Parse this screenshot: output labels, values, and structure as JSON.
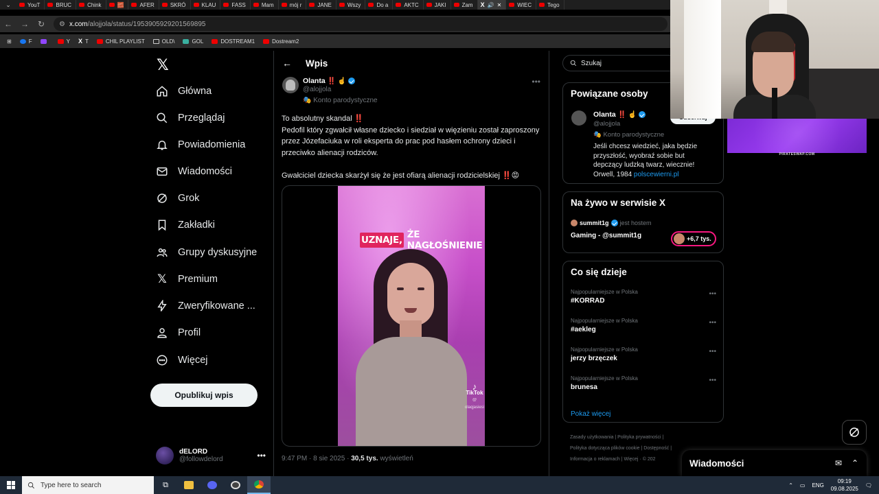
{
  "browser": {
    "tabs": [
      {
        "label": "YouT"
      },
      {
        "label": "BRUC"
      },
      {
        "label": "Chink"
      },
      {
        "label": "🧱"
      },
      {
        "label": "AFER"
      },
      {
        "label": "SKRÓ"
      },
      {
        "label": "KLAU"
      },
      {
        "label": "FASS"
      },
      {
        "label": "Mam"
      },
      {
        "label": "mój r"
      },
      {
        "label": "JANE"
      },
      {
        "label": "Wszy"
      },
      {
        "label": "Do a"
      },
      {
        "label": "AKTC"
      },
      {
        "label": "JAKI"
      },
      {
        "label": "Zam"
      },
      {
        "label": "X"
      },
      {
        "label": "WIEC"
      },
      {
        "label": "Tego"
      }
    ],
    "url_domain": "x.com",
    "url_path": "/alojjola/status/1953905929201569895",
    "bookmarks": [
      {
        "label": "F"
      },
      {
        "label": ""
      },
      {
        "label": "Y"
      },
      {
        "label": "T"
      },
      {
        "label": "CHIL PLAYLIST"
      },
      {
        "label": "OLD\\"
      },
      {
        "label": "GOL"
      },
      {
        "label": "DOSTREAM1"
      },
      {
        "label": "Dostream2"
      }
    ]
  },
  "sidebar": {
    "nav": [
      {
        "label": "Główna"
      },
      {
        "label": "Przeglądaj"
      },
      {
        "label": "Powiadomienia"
      },
      {
        "label": "Wiadomości"
      },
      {
        "label": "Grok"
      },
      {
        "label": "Zakładki"
      },
      {
        "label": "Grupy dyskusyjne"
      },
      {
        "label": "Premium"
      },
      {
        "label": "Zweryfikowane ..."
      },
      {
        "label": "Profil"
      },
      {
        "label": "Więcej"
      }
    ],
    "post_button": "Opublikuj wpis",
    "account": {
      "name": "dELORD",
      "handle": "@followdelord"
    }
  },
  "main": {
    "title": "Wpis",
    "author": {
      "name": "Olanta",
      "emojis": "‼️ ☝️",
      "handle": "@alojjola",
      "parody_label": "Konto parodystyczne"
    },
    "text": "To absolutny skandal ‼️\nPedofil który zgwałcił własne dziecko i siedział w więzieniu został zaproszony przez Józefaciuka w roli eksperta do prac pod hasłem ochrony dzieci i przeciwko alienacji rodziców.\n\nGwałciciel dziecka skarżył się że jest ofiarą alienacji rodzicielskiej ‼️😡",
    "video_caption_highlight": "UZNAJE,",
    "video_caption_rest": "ŻE NAGŁOŚNIENIE",
    "tiktok_label": "TikTok",
    "tiktok_handle": "@ olaqjasiesi",
    "time": "9:47 PM",
    "date": "8 sie 2025",
    "views": "30,5 tys.",
    "views_label": "wyświetleń"
  },
  "right": {
    "search_placeholder": "Szukaj",
    "related": {
      "title": "Powiązane osoby",
      "name": "Olanta",
      "emojis": "‼️ ☝️",
      "handle": "@alojjola",
      "parody_label": "Konto parodystyczne",
      "follow_label": "Obserwuj",
      "bio": "Jeśli chcesz wiedzieć, jaka będzie przyszłość, wyobraź sobie but depczący ludzką twarz, wiecznie! Orwell, 1984",
      "bio_link": "polscewierni.pl"
    },
    "live": {
      "title": "Na żywo w serwisie X",
      "host": "summit1g",
      "host_suffix": "jest hostem",
      "stream_title": "Gaming - @summit1g",
      "listeners": "+6,7 tys."
    },
    "trends": {
      "title": "Co się dzieje",
      "items": [
        {
          "context": "Najpopularniejsze w Polska",
          "name": "#KORRAD"
        },
        {
          "context": "Najpopularniejsze w Polska",
          "name": "#aekleg"
        },
        {
          "context": "Najpopularniejsze w Polska",
          "name": "jerzy brzęczek"
        },
        {
          "context": "Najpopularniejsze w Polska",
          "name": "brunesa"
        }
      ],
      "show_more": "Pokaż więcej"
    },
    "footer": {
      "links": [
        "Zasady użytkowania",
        "Polityka prywatności",
        "Polityka dotycząca plików cookie",
        "Dostępność",
        "Informacja o reklamach",
        "Więcej",
        "© 202"
      ]
    }
  },
  "overlay": {
    "stream_label": "PIRATESWAP.COM",
    "dm_title": "Wiadomości"
  },
  "taskbar": {
    "search_placeholder": "Type here to search",
    "language": "ENG",
    "time": "09:19",
    "date": "09.08.2025"
  }
}
